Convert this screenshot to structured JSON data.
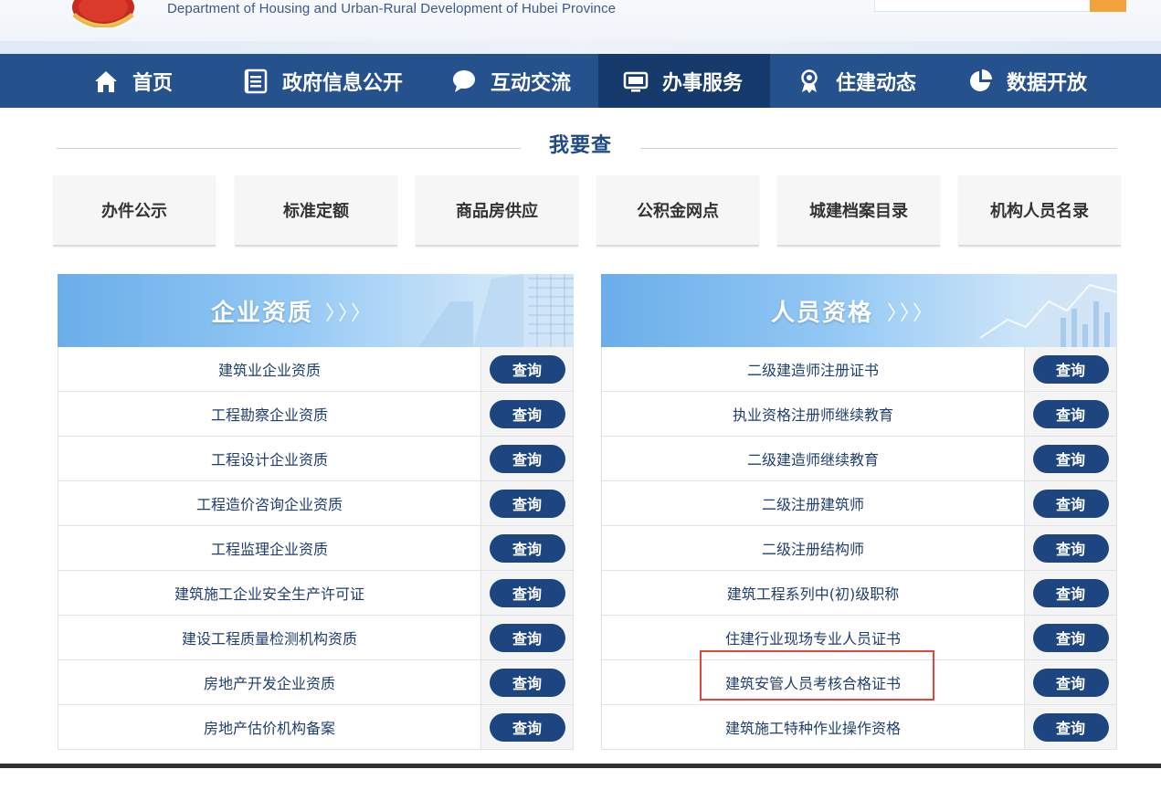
{
  "header": {
    "dept_en": "Department of Housing and Urban-Rural Development of Hubei Province",
    "emblem_icon": "national-emblem",
    "search_icon": "search-icon",
    "accent": "#f2a43a"
  },
  "nav": {
    "bg": "#25518c",
    "active_bg": "#163a6c",
    "items": [
      {
        "label": "首页",
        "icon": "home-icon"
      },
      {
        "label": "政府信息公开",
        "icon": "document-list-icon"
      },
      {
        "label": "互动交流",
        "icon": "chat-bubble-icon"
      },
      {
        "label": "办事服务",
        "icon": "monitor-icon",
        "active": true
      },
      {
        "label": "住建动态",
        "icon": "award-ribbon-icon"
      },
      {
        "label": "数据开放",
        "icon": "pie-chart-icon"
      }
    ]
  },
  "section": {
    "title": "我要查"
  },
  "quick": [
    "办件公示",
    "标准定额",
    "商品房供应",
    "公积金网点",
    "城建档案目录",
    "机构人员名录"
  ],
  "panels": {
    "query_label": "查询",
    "enterprise": {
      "title": "企业资质",
      "chevrons": "〉〉〉",
      "items": [
        "建筑业企业资质",
        "工程勘察企业资质",
        "工程设计企业资质",
        "工程造价咨询企业资质",
        "工程监理企业资质",
        "建筑施工企业安全生产许可证",
        "建设工程质量检测机构资质",
        "房地产开发企业资质",
        "房地产估价机构备案"
      ]
    },
    "personnel": {
      "title": "人员资格",
      "chevrons": "〉〉〉",
      "items": [
        "二级建造师注册证书",
        "执业资格注册师继续教育",
        "二级建造师继续教育",
        "二级注册建筑师",
        "二级注册结构师",
        "建筑工程系列中(初)级职称",
        "住建行业现场专业人员证书",
        "建筑安管人员考核合格证书",
        "建筑施工特种作业操作资格"
      ]
    }
  }
}
